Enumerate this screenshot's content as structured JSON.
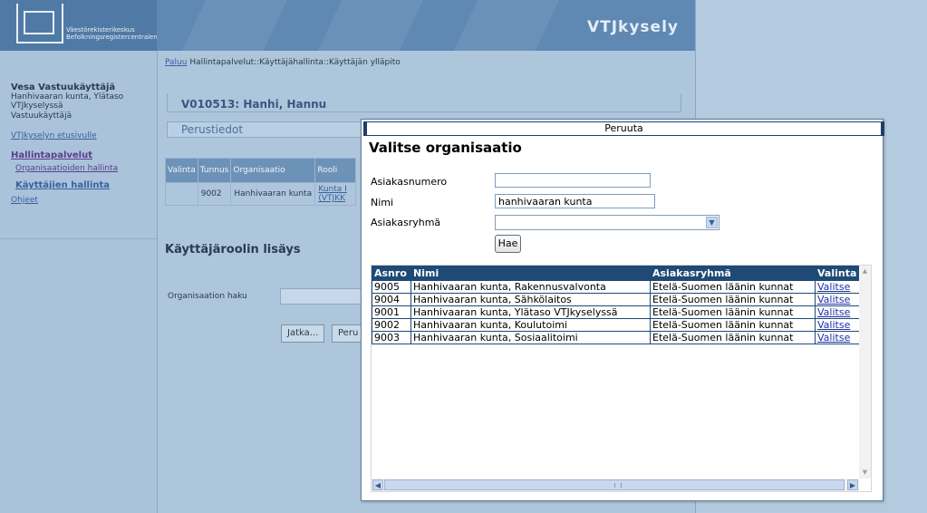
{
  "header": {
    "logo_text": "Väestörekisterikeskus Befolkningsregistercentralen",
    "brand": "VTJkysely"
  },
  "sidebar": {
    "user_name": "Vesa Vastuukäyttäjä",
    "user_lines": [
      "Hanhivaaran kunta, Ylätaso",
      "VTJkyselyssä",
      "Vastuukäyttäjä"
    ],
    "home_link": "VTJkyselyn etusivulle",
    "section": "Hallintapalvelut",
    "org_link": "Organisaatioiden hallinta",
    "users_link": "Käyttäjien hallinta",
    "help_link": "Ohjeet"
  },
  "content": {
    "breadcrumb_back": "Paluu",
    "breadcrumb_path": "Hallintapalvelut::Käyttäjähallinta::Käyttäjän ylläpito",
    "user_title": "V010513: Hanhi, Hannu",
    "tab_basic": "Perustiedot",
    "table_headers": [
      "Valinta",
      "Tunnus",
      "Organisaatio",
      "Rooli"
    ],
    "table_row": {
      "tunnus": "9002",
      "organisaatio": "Hanhivaaran kunta",
      "rooli": "Kunta I (VTJKK"
    },
    "section_title": "Käyttäjäroolin lisäys",
    "search_label": "Organisaation haku",
    "btn_next": "Jatka...",
    "btn_cancel": "Peru"
  },
  "modal": {
    "cancel_label": "Peruuta",
    "title": "Valitse organisaatio",
    "label_customer_number": "Asiakasnumero",
    "customer_number_value": "",
    "label_name": "Nimi",
    "name_value": "hanhivaaran kunta",
    "label_group": "Asiakasryhmä",
    "group_value": "",
    "search_button": "Hae",
    "columns": [
      "Asnro",
      "Nimi",
      "Asiakasryhmä",
      "Valinta"
    ],
    "rows": [
      {
        "asnro": "9005",
        "nimi": "Hanhivaaran kunta, Rakennusvalvonta",
        "ryhma": "Etelä-Suomen läänin kunnat",
        "valinta": "Valitse"
      },
      {
        "asnro": "9004",
        "nimi": "Hanhivaaran kunta, Sähkölaitos",
        "ryhma": "Etelä-Suomen läänin kunnat",
        "valinta": "Valitse"
      },
      {
        "asnro": "9001",
        "nimi": "Hanhivaaran kunta, Ylätaso VTJkyselyssä",
        "ryhma": "Etelä-Suomen läänin kunnat",
        "valinta": "Valitse"
      },
      {
        "asnro": "9002",
        "nimi": "Hanhivaaran kunta, Koulutoimi",
        "ryhma": "Etelä-Suomen läänin kunnat",
        "valinta": "Valitse"
      },
      {
        "asnro": "9003",
        "nimi": "Hanhivaaran kunta, Sosiaalitoimi",
        "ryhma": "Etelä-Suomen läänin kunnat",
        "valinta": "Valitse"
      }
    ]
  },
  "colors": {
    "header_table": "#1f4a75",
    "link": "#1d2fa8",
    "app_background": "#aec6dc"
  }
}
